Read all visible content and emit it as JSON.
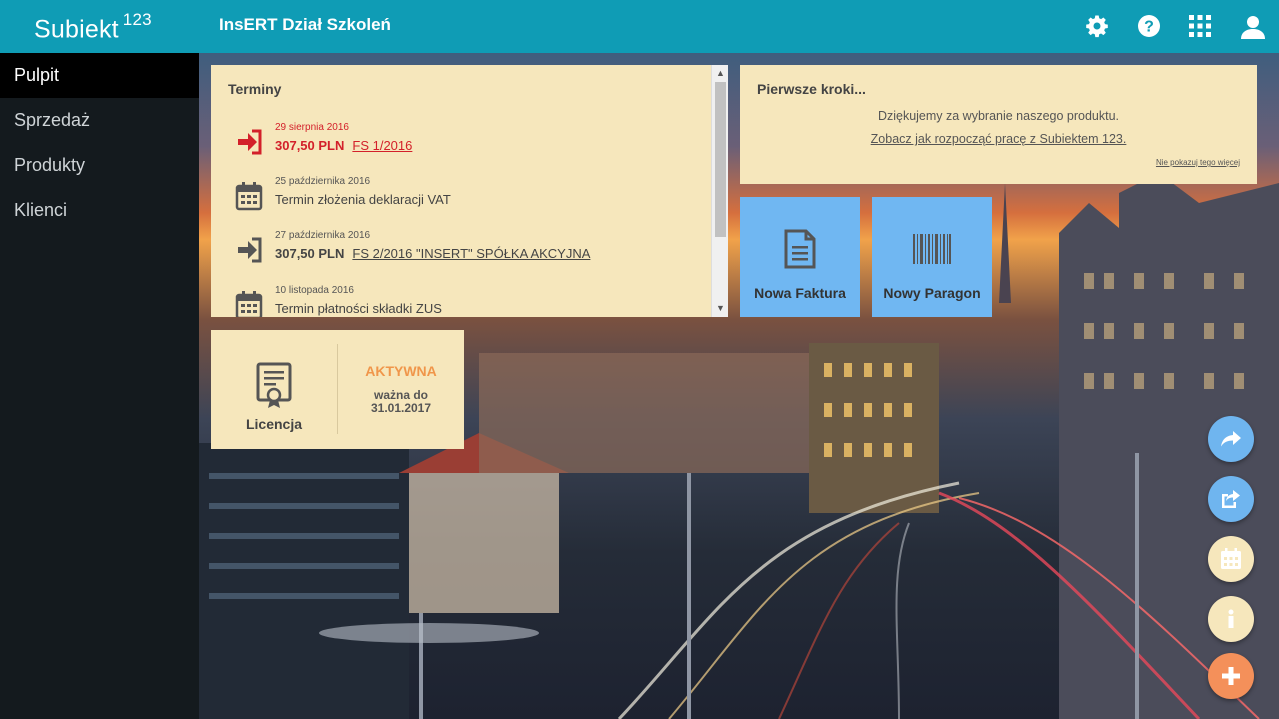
{
  "header": {
    "logo": "Subiekt",
    "logo_suffix": "123",
    "company": "InsERT Dział Szkoleń",
    "icons": [
      "gear-icon",
      "help-icon",
      "apps-grid-icon",
      "user-icon"
    ]
  },
  "sidebar": {
    "items": [
      {
        "label": "Pulpit",
        "active": true
      },
      {
        "label": "Sprzedaż",
        "active": false
      },
      {
        "label": "Produkty",
        "active": false
      },
      {
        "label": "Klienci",
        "active": false
      }
    ]
  },
  "terminy": {
    "title": "Terminy",
    "items": [
      {
        "icon": "sign-in-arrow-icon",
        "status": "overdue",
        "date": "29 sierpnia 2016",
        "amount": "307,50 PLN",
        "doc": "FS 1/2016"
      },
      {
        "icon": "calendar-icon",
        "status": "normal",
        "date": "25 października 2016",
        "text": "Termin złożenia deklaracji VAT"
      },
      {
        "icon": "sign-in-arrow-icon",
        "status": "normal",
        "date": "27 października 2016",
        "amount": "307,50 PLN",
        "doc": "FS 2/2016 \"INSERT\" SPÓŁKA AKCYJNA"
      },
      {
        "icon": "calendar-icon",
        "status": "normal",
        "date": "10 listopada 2016",
        "text": "Termin płatności składki ZUS"
      }
    ]
  },
  "kroki": {
    "title": "Pierwsze kroki...",
    "line1": "Dziękujemy za wybranie naszego produktu.",
    "line2": "Zobacz jak rozpocząć pracę z Subiektem 123.",
    "dismiss": "Nie pokazuj tego więcej"
  },
  "tiles": [
    {
      "label": "Nowa Faktura",
      "icon": "document-icon"
    },
    {
      "label": "Nowy Paragon",
      "icon": "barcode-icon"
    }
  ],
  "licencja": {
    "label": "Licencja",
    "icon": "certificate-icon",
    "status": "AKTYWNA",
    "valid_label": "ważna do",
    "valid_date": "31.01.2017"
  },
  "fabs": [
    {
      "icon": "share-forward-icon",
      "color": "#6fb5ef"
    },
    {
      "icon": "export-icon",
      "color": "#6fb5ef"
    },
    {
      "icon": "calendar-icon",
      "color": "#f6e7bc"
    },
    {
      "icon": "info-icon",
      "color": "#f6e7bc"
    },
    {
      "icon": "plus-icon",
      "color": "#f4905a"
    }
  ],
  "colors": {
    "topbar": "#0f9cb5",
    "sidebar": "#141a1e",
    "panel": "#f6e7bc",
    "tile": "#70b7f2",
    "overdue": "#d3202a",
    "status_active": "#f0964a"
  }
}
